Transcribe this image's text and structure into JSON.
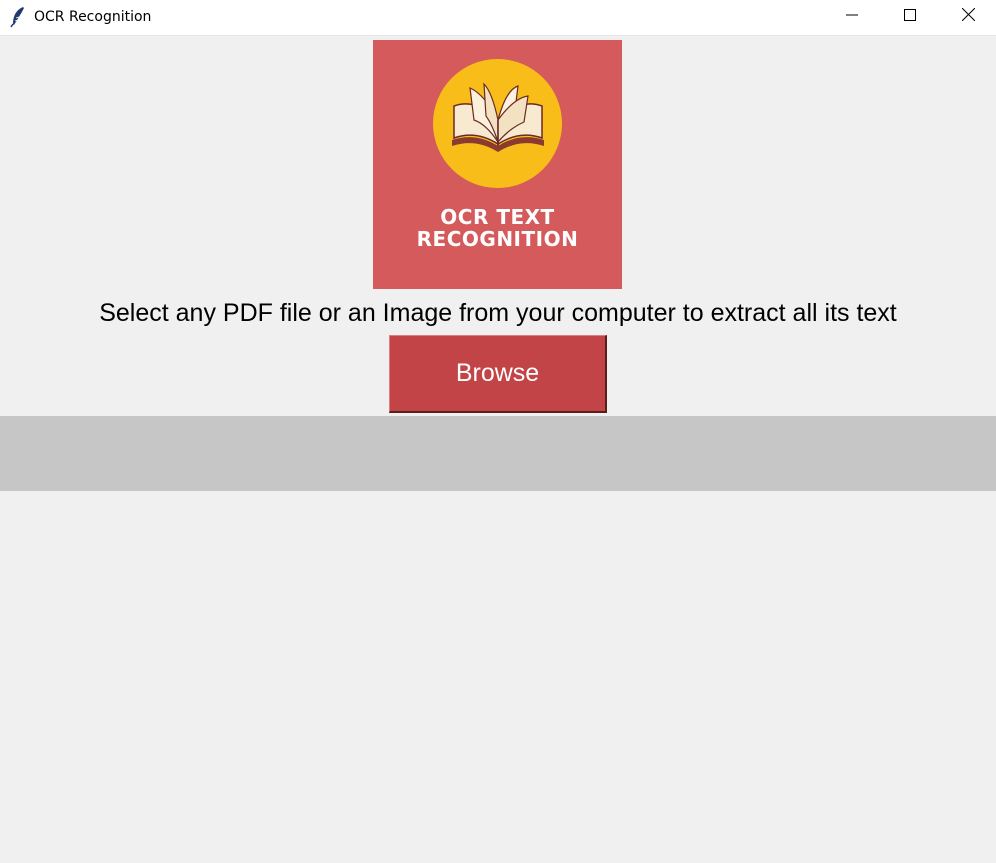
{
  "window": {
    "title": "OCR Recognition",
    "icon": "feather-icon",
    "controls": [
      "minimize-icon",
      "maximize-icon",
      "close-icon"
    ]
  },
  "logo": {
    "icon": "open-book-icon",
    "line1": "OCR TEXT",
    "line2": "RECOGNITION",
    "colors": {
      "background": "#d45a5b",
      "circle": "#f8bd19"
    }
  },
  "main": {
    "instruction": "Select any PDF file or an Image from your computer to extract all its text",
    "browse_label": "Browse",
    "browse_color": "#c34446",
    "output_text": ""
  }
}
